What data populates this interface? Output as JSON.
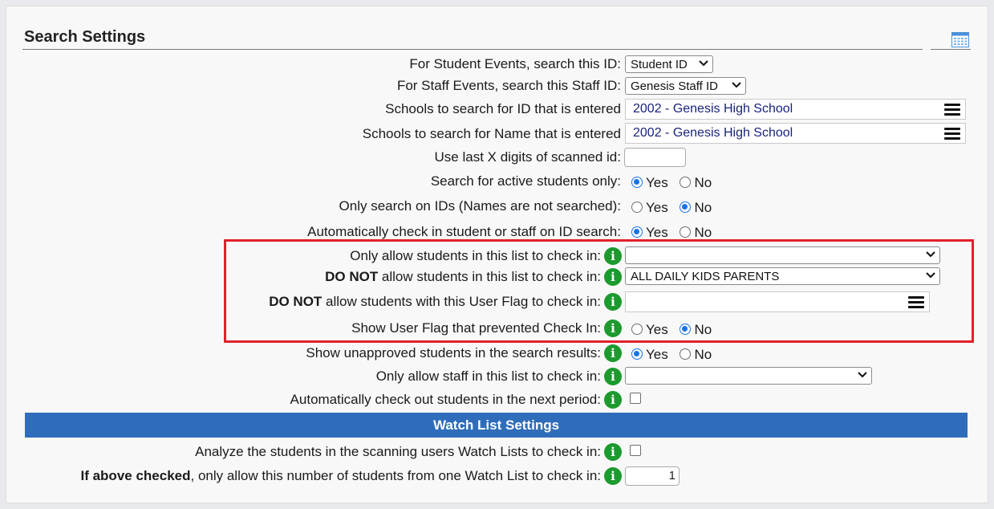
{
  "panel": {
    "title": "Search Settings"
  },
  "rows": {
    "student_id": {
      "label": "For Student Events, search this ID:",
      "value": "Student ID"
    },
    "staff_id": {
      "label": "For Staff Events, search this Staff ID:",
      "value": "Genesis Staff ID"
    },
    "schools_id": {
      "label": "Schools to search for ID that is entered",
      "value": "2002 - Genesis High School"
    },
    "schools_name": {
      "label": "Schools to search for Name that is entered",
      "value": "2002 - Genesis High School"
    },
    "last_digits": {
      "label": "Use last X digits of scanned id:",
      "value": ""
    },
    "active_only": {
      "label": "Search for active students only:",
      "selected": "Yes"
    },
    "ids_only": {
      "label": "Only search on IDs (Names are not searched):",
      "selected": "No"
    },
    "auto_checkin": {
      "label": "Automatically check in student or staff on ID search:",
      "selected": "Yes"
    },
    "allow_list": {
      "label": "Only allow students in this list to check in:",
      "value": ""
    },
    "deny_list": {
      "label_bold": "DO NOT",
      "label_rest": " allow students in this list to check in:",
      "value": "ALL DAILY KIDS PARENTS"
    },
    "deny_flag": {
      "label_bold": "DO NOT",
      "label_rest": " allow students with this User Flag to check in:",
      "value": ""
    },
    "show_flag": {
      "label": "Show User Flag that prevented Check In:",
      "selected": "No"
    },
    "show_unapproved": {
      "label": "Show unapproved students in the search results:",
      "selected": "Yes"
    },
    "staff_list": {
      "label": "Only allow staff in this list to check in:",
      "value": ""
    },
    "auto_checkout": {
      "label": "Automatically check out students in the next period:",
      "checked": false
    }
  },
  "watch": {
    "banner": "Watch List Settings",
    "analyze": {
      "label": "Analyze the students in the scanning users Watch Lists to check in:",
      "checked": false
    },
    "limit": {
      "label_bold": "If above checked",
      "label_rest": ", only allow this number of students from one Watch List to check in:",
      "value": "1"
    }
  },
  "options": {
    "yes": "Yes",
    "no": "No"
  },
  "info_glyph": "i",
  "colors": {
    "banner": "#2f6dbb",
    "info": "#1c9a2e",
    "highlight_border": "#e2202c",
    "radio": "#1a73e8",
    "school_text": "#1a237e"
  },
  "icons": {
    "calendar": "calendar-icon",
    "info": "info-icon",
    "chevron": "chevron-down-icon",
    "menu": "hamburger-menu-icon"
  }
}
